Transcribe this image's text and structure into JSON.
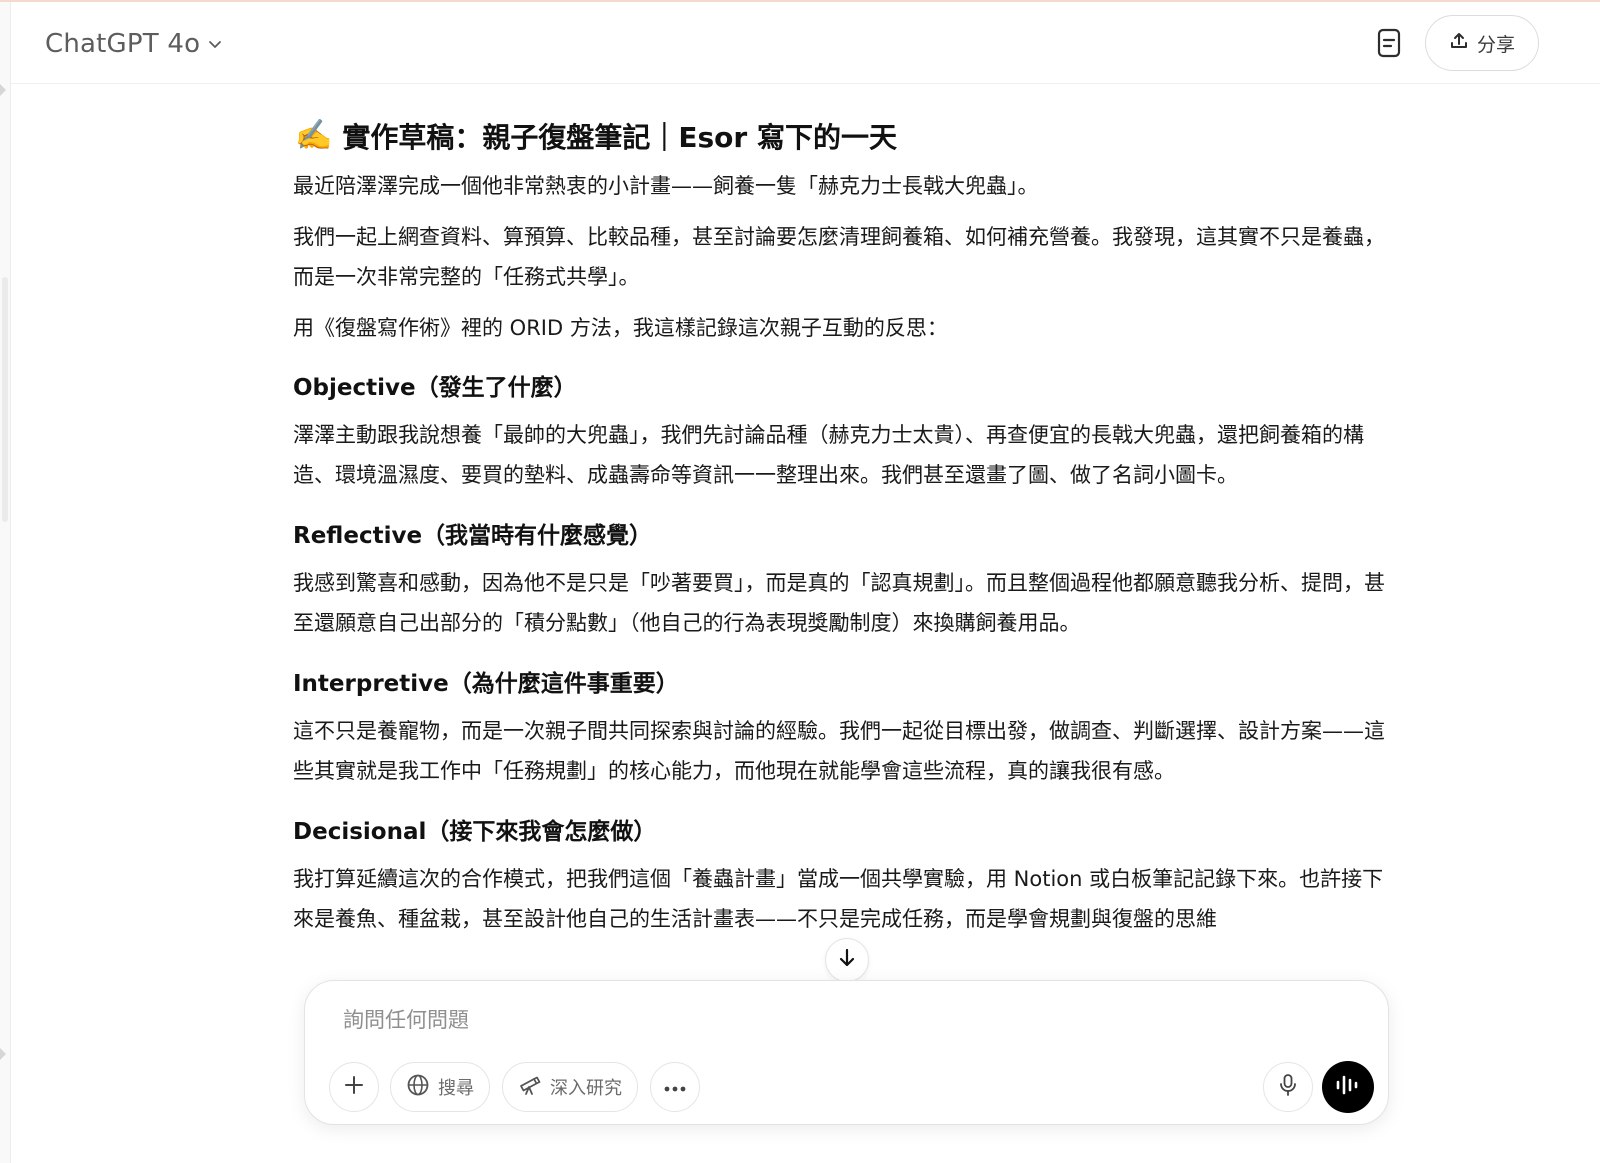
{
  "header": {
    "model_name": "ChatGPT 4o",
    "share_label": "分享"
  },
  "message": {
    "title_emoji": "✍️",
    "title": "實作草稿：親子復盤筆記｜Esor 寫下的一天",
    "intro": [
      "最近陪澤澤完成一個他非常熱衷的小計畫——飼養一隻「赫克力士長戟大兜蟲」。",
      "我們一起上網查資料、算預算、比較品種，甚至討論要怎麼清理飼養箱、如何補充營養。我發現，這其實不只是養蟲，而是一次非常完整的「任務式共學」。",
      "用《復盤寫作術》裡的 ORID 方法，我這樣記錄這次親子互動的反思："
    ],
    "sections": [
      {
        "heading": "Objective（發生了什麼）",
        "body": "澤澤主動跟我說想養「最帥的大兜蟲」，我們先討論品種（赫克力士太貴）、再查便宜的長戟大兜蟲，還把飼養箱的構造、環境溫濕度、要買的墊料、成蟲壽命等資訊一一整理出來。我們甚至還畫了圖、做了名詞小圖卡。"
      },
      {
        "heading": "Reflective（我當時有什麼感覺）",
        "body": "我感到驚喜和感動，因為他不是只是「吵著要買」，而是真的「認真規劃」。而且整個過程他都願意聽我分析、提問，甚至還願意自己出部分的「積分點數」（他自己的行為表現獎勵制度）來換購飼養用品。"
      },
      {
        "heading": "Interpretive（為什麼這件事重要）",
        "body": "這不只是養寵物，而是一次親子間共同探索與討論的經驗。我們一起從目標出發，做調查、判斷選擇、設計方案——這些其實就是我工作中「任務規劃」的核心能力，而他現在就能學會這些流程，真的讓我很有感。"
      },
      {
        "heading": "Decisional（接下來我會怎麼做）",
        "body": "我打算延續這次的合作模式，把我們這個「養蟲計畫」當成一個共學實驗，用 Notion 或白板筆記記錄下來。也許接下來是養魚、種盆栽，甚至設計他自己的生活計畫表——不只是完成任務，而是學會規劃與復盤的思維"
      }
    ]
  },
  "composer": {
    "placeholder": "詢問任何問題",
    "search_label": "搜尋",
    "deep_research_label": "深入研究"
  },
  "icons": [
    "chevron-down-icon",
    "document-icon",
    "share-icon",
    "plus-icon",
    "globe-icon",
    "telescope-icon",
    "more-icon",
    "mic-icon",
    "voice-wave-icon",
    "arrow-down-icon"
  ]
}
